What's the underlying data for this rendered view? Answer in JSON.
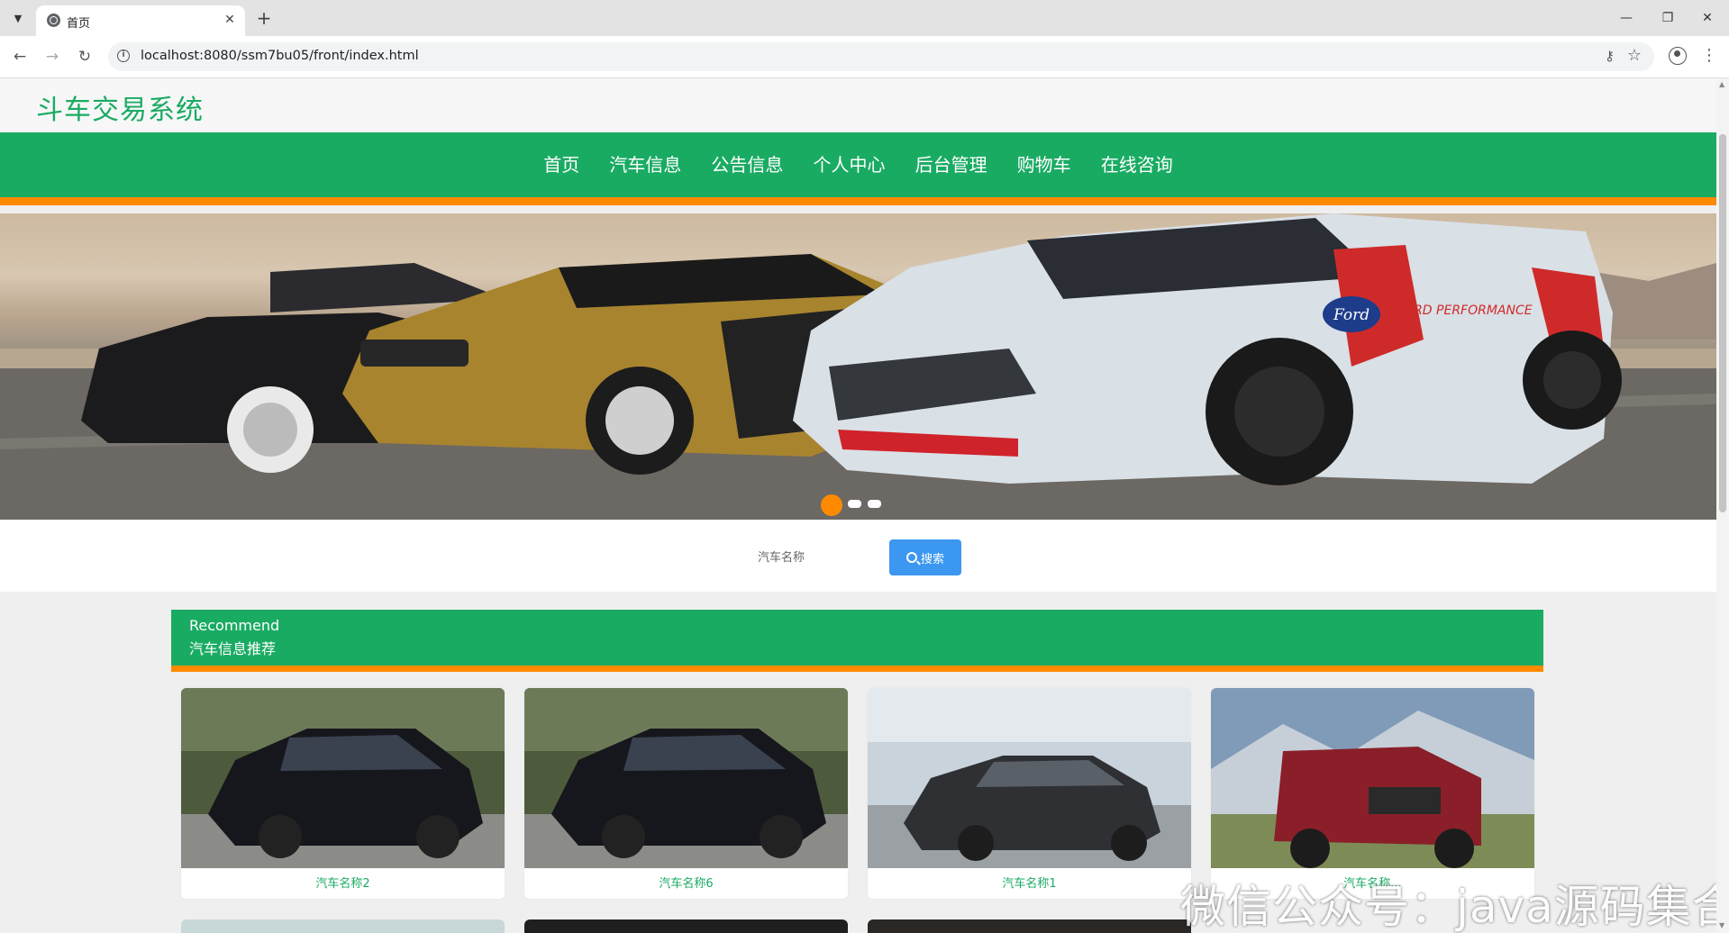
{
  "browser": {
    "tab_title": "首页",
    "url": "localhost:8080/ssm7bu05/front/index.html",
    "new_tab_symbol": "+",
    "close_symbol": "✕",
    "window_controls": [
      "—",
      "❐",
      "✕"
    ]
  },
  "site": {
    "title": "斗车交易系统"
  },
  "nav": {
    "items": [
      "首页",
      "汽车信息",
      "公告信息",
      "个人中心",
      "后台管理",
      "购物车",
      "在线咨询"
    ]
  },
  "banner": {
    "slide_count": 3,
    "active_index": 0,
    "brand_text": "Ford",
    "performance_text": "FORD PERFORMANCE"
  },
  "search": {
    "placeholder": "汽车名称",
    "button_label": "搜索"
  },
  "recommend": {
    "title_en": "Recommend",
    "title_cn": "汽车信息推荐",
    "cards": [
      {
        "name": "汽车名称2"
      },
      {
        "name": "汽车名称6"
      },
      {
        "name": "汽车名称1"
      },
      {
        "name": "汽车名称..."
      }
    ]
  },
  "watermark": "微信公众号：java源码集合",
  "colors": {
    "brand_green": "#1aab63",
    "accent_orange": "#ff8a00",
    "search_blue": "#3b97f0"
  }
}
